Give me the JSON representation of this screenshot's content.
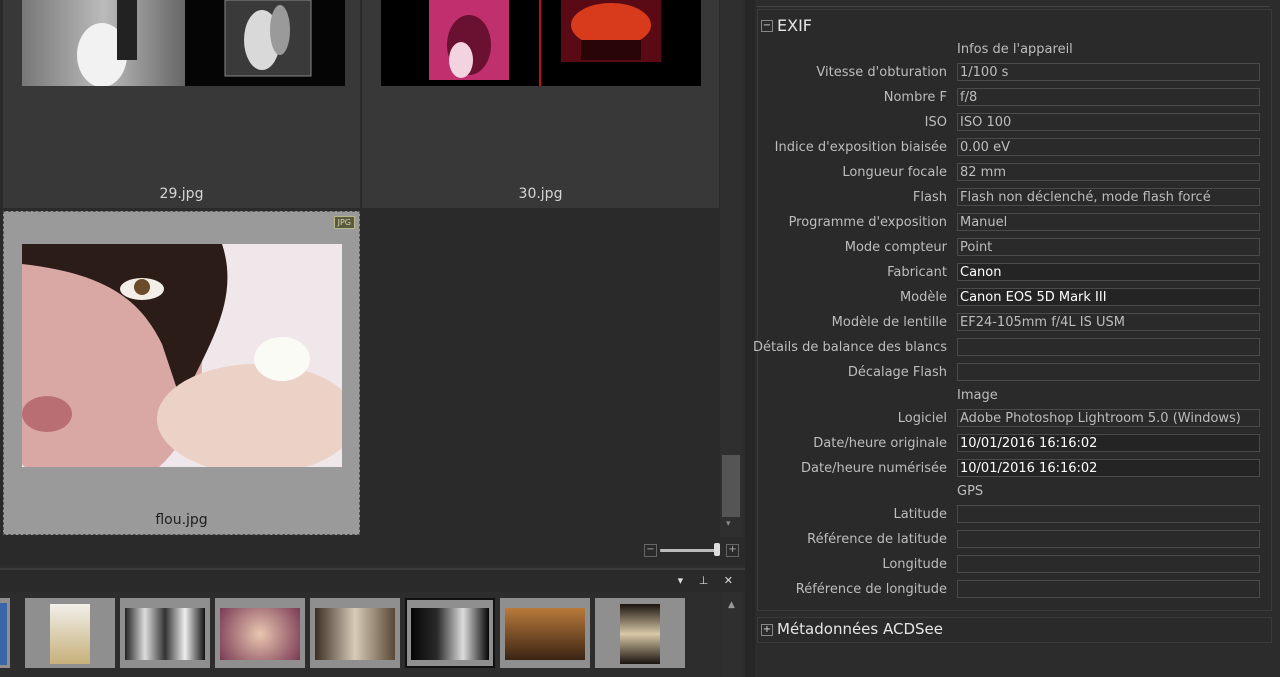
{
  "grid": {
    "items": [
      {
        "filename": "29.jpg"
      },
      {
        "filename": "30.jpg"
      },
      {
        "filename": "flou.jpg",
        "badge": "JPG",
        "selected": true
      }
    ]
  },
  "zoom": {
    "minus": "−",
    "plus": "+"
  },
  "strip": {
    "icons": "▾ ⊥ ✕",
    "up": "▲"
  },
  "exif": {
    "title": "EXIF",
    "toggle": "−",
    "groups": {
      "camera": "Infos de l'appareil",
      "image": "Image",
      "gps": "GPS"
    },
    "rows": [
      {
        "label": "Vitesse d'obturation",
        "value": "1/100 s"
      },
      {
        "label": "Nombre F",
        "value": "f/8"
      },
      {
        "label": "ISO",
        "value": "ISO 100"
      },
      {
        "label": "Indice d'exposition biaisée",
        "value": "0.00 eV"
      },
      {
        "label": "Longueur focale",
        "value": "82 mm"
      },
      {
        "label": "Flash",
        "value": "Flash non déclenché, mode flash forcé"
      },
      {
        "label": "Programme d'exposition",
        "value": "Manuel"
      },
      {
        "label": "Mode compteur",
        "value": "Point"
      },
      {
        "label": "Fabricant",
        "value": "Canon"
      },
      {
        "label": "Modèle",
        "value": "Canon EOS 5D Mark III"
      },
      {
        "label": "Modèle de lentille",
        "value": "EF24-105mm f/4L IS USM"
      },
      {
        "label": "Détails de balance des blancs",
        "value": ""
      },
      {
        "label": "Décalage Flash",
        "value": ""
      },
      {
        "label": "Logiciel",
        "value": "Adobe Photoshop Lightroom 5.0 (Windows)"
      },
      {
        "label": "Date/heure originale",
        "value": "10/01/2016 16:16:02"
      },
      {
        "label": "Date/heure numérisée",
        "value": "10/01/2016 16:16:02"
      },
      {
        "label": "Latitude",
        "value": ""
      },
      {
        "label": "Référence de latitude",
        "value": ""
      },
      {
        "label": "Longitude",
        "value": ""
      },
      {
        "label": "Référence de longitude",
        "value": ""
      }
    ]
  },
  "acdsee": {
    "title": "Métadonnées ACDSee",
    "toggle": "+"
  }
}
